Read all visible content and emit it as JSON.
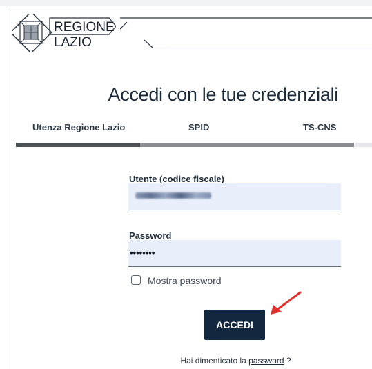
{
  "brand": {
    "line1": "REGIONE",
    "line2": "LAZIO"
  },
  "page": {
    "title": "Accedi con le tue credenziali"
  },
  "tabs": [
    {
      "label": "Utenza Regione Lazio",
      "active": true
    },
    {
      "label": "SPID",
      "active": false
    },
    {
      "label": "TS-CNS",
      "active": false
    }
  ],
  "form": {
    "username_label": "Utente (codice fiscale)",
    "username_value": "RDLVLR68L74D984",
    "password_label": "Password",
    "password_value": "••••••••",
    "show_password_label": "Mostra password",
    "show_password_checked": false,
    "submit_label": "ACCEDI"
  },
  "footer": {
    "forgot_prefix": "Hai dimenticato la",
    "forgot_link": "password",
    "forgot_suffix": "?"
  },
  "colors": {
    "primary": "#13283f",
    "field_bg": "#e9eefb",
    "tab_bar": "#8a8e92",
    "annotation_arrow": "#e0312e"
  },
  "icons": {
    "logo": "regione-lazio-logo-icon",
    "arrow": "annotation-arrow-icon"
  }
}
